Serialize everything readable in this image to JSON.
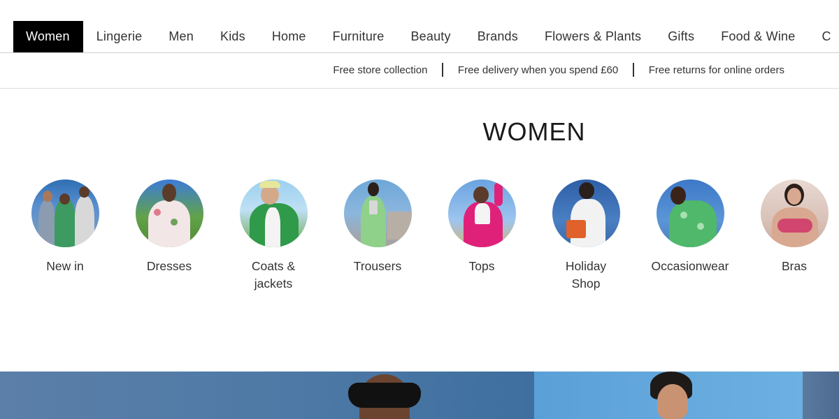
{
  "nav": {
    "items": [
      {
        "label": "Women",
        "active": true
      },
      {
        "label": "Lingerie"
      },
      {
        "label": "Men"
      },
      {
        "label": "Kids"
      },
      {
        "label": "Home"
      },
      {
        "label": "Furniture"
      },
      {
        "label": "Beauty"
      },
      {
        "label": "Brands"
      },
      {
        "label": "Flowers & Plants"
      },
      {
        "label": "Gifts"
      },
      {
        "label": "Food & Wine"
      },
      {
        "label": "C"
      }
    ]
  },
  "promo": {
    "items": [
      "Free store collection",
      "Free delivery when you spend £60",
      "Free returns for online orders"
    ]
  },
  "page": {
    "title": "WOMEN"
  },
  "categories": [
    {
      "label": "New in"
    },
    {
      "label": "Dresses"
    },
    {
      "label": "Coats &\njackets"
    },
    {
      "label": "Trousers"
    },
    {
      "label": "Tops"
    },
    {
      "label": "Holiday\nShop"
    },
    {
      "label": "Occasionwear"
    },
    {
      "label": "Bras"
    }
  ],
  "colors": {
    "active_nav_bg": "#000000",
    "active_nav_text": "#ffffff",
    "text": "#333333",
    "divider": "#cfcfcf"
  }
}
